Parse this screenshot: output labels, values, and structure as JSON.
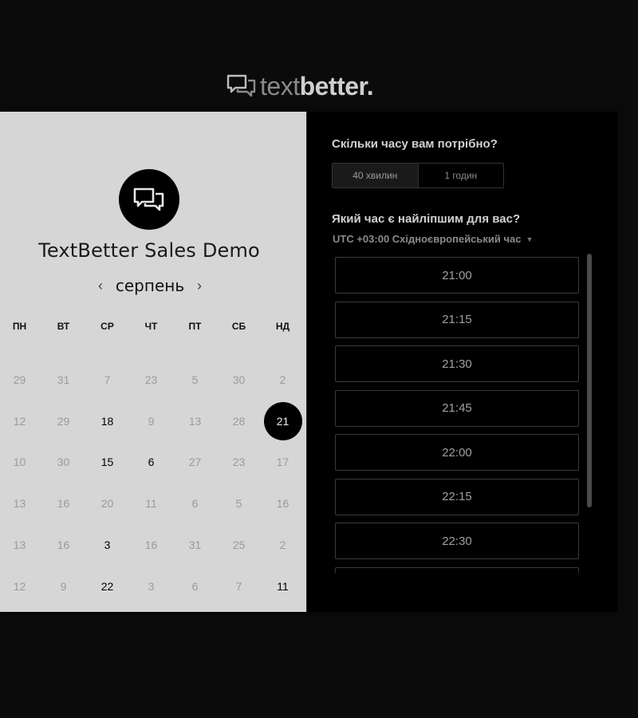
{
  "brand": {
    "logo_icon": "chat-bubbles-icon",
    "text_light": "text",
    "text_bold": "better",
    "text_dot": "."
  },
  "event": {
    "logo_icon": "chat-bubbles-icon",
    "title": "TextBetter Sales Demo"
  },
  "calendar": {
    "month": "серпень",
    "prev_icon": "chevron-left-icon",
    "next_icon": "chevron-right-icon",
    "weekdays": [
      "ПН",
      "ВТ",
      "СР",
      "ЧТ",
      "ПТ",
      "СБ",
      "НД"
    ],
    "weeks": [
      [
        "29",
        "31",
        "7",
        "23",
        "5",
        "30",
        "2"
      ],
      [
        "12",
        "29",
        "18",
        "9",
        "13",
        "28",
        "21"
      ],
      [
        "10",
        "30",
        "15",
        "6",
        "27",
        "23",
        "17"
      ],
      [
        "13",
        "16",
        "20",
        "11",
        "6",
        "5",
        "16"
      ],
      [
        "13",
        "16",
        "3",
        "16",
        "31",
        "25",
        "2"
      ],
      [
        "12",
        "9",
        "22",
        "3",
        "6",
        "7",
        "11"
      ]
    ]
  },
  "duration": {
    "question": "Скільки часу вам потрібно?",
    "options": [
      "40 хвилин",
      "1 годин"
    ],
    "selected": "40 хвилин"
  },
  "time": {
    "question": "Який час є найліпшим для вас?",
    "timezone": "UTC +03:00 Східноєвропейський час",
    "slots": [
      "21:00",
      "21:15",
      "21:30",
      "21:45",
      "22:00",
      "22:15",
      "22:30",
      ""
    ]
  },
  "colors": {
    "page_bg": "#0b0b0b",
    "left_panel_bg": "#d6d6d6",
    "right_panel_bg": "#000000",
    "selected_day_bg": "#000000"
  }
}
